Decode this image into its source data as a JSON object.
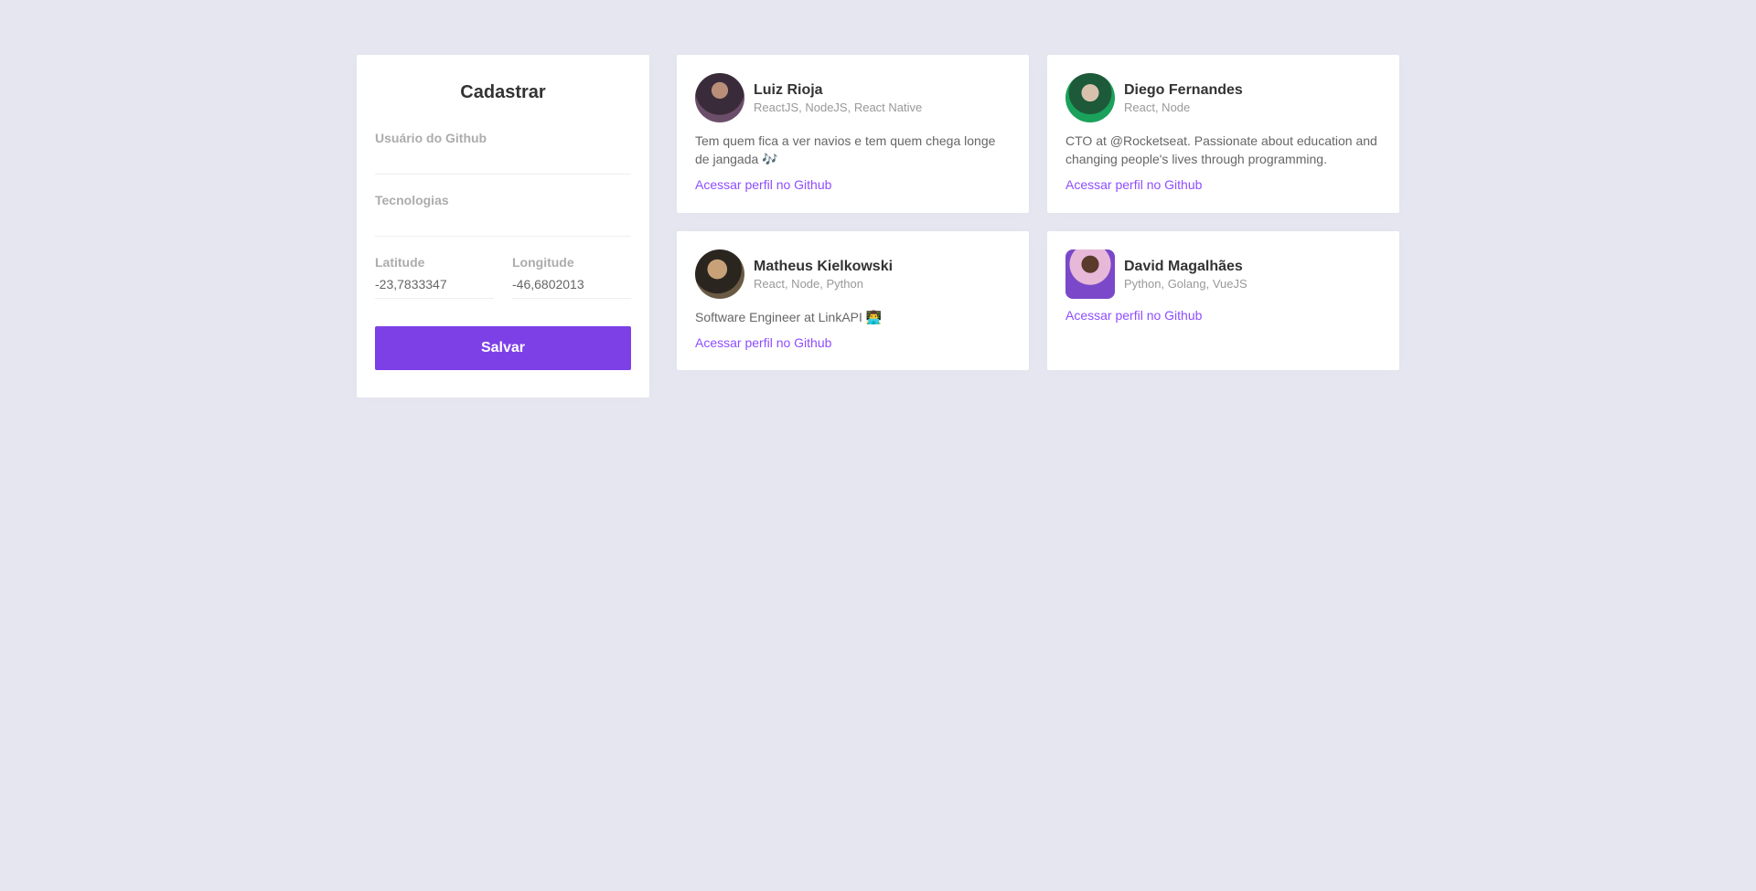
{
  "sidebar": {
    "title": "Cadastrar",
    "fields": {
      "github_username": {
        "label": "Usuário do Github",
        "value": ""
      },
      "techs": {
        "label": "Tecnologias",
        "value": ""
      },
      "latitude": {
        "label": "Latitude",
        "value": "-23,7833347"
      },
      "longitude": {
        "label": "Longitude",
        "value": "-46,6802013"
      }
    },
    "save_label": "Salvar"
  },
  "devs": [
    {
      "name": "Luiz Rioja",
      "techs": "ReactJS, NodeJS, React Native",
      "bio": "Tem quem fica a ver navios e tem quem chega longe de jangada 🎶",
      "link": "Acessar perfil no Github"
    },
    {
      "name": "Diego Fernandes",
      "techs": "React, Node",
      "bio": "CTO at @Rocketseat. Passionate about education and changing people's lives through programming.",
      "link": "Acessar perfil no Github"
    },
    {
      "name": "Matheus Kielkowski",
      "techs": "React, Node, Python",
      "bio": "Software Engineer at LinkAPI 👨‍💻",
      "link": "Acessar perfil no Github"
    },
    {
      "name": "David Magalhães",
      "techs": "Python, Golang, VueJS",
      "bio": "",
      "link": "Acessar perfil no Github"
    }
  ],
  "colors": {
    "background": "#e5e6f0",
    "accent": "#7d40e7",
    "link": "#8e4dff"
  }
}
